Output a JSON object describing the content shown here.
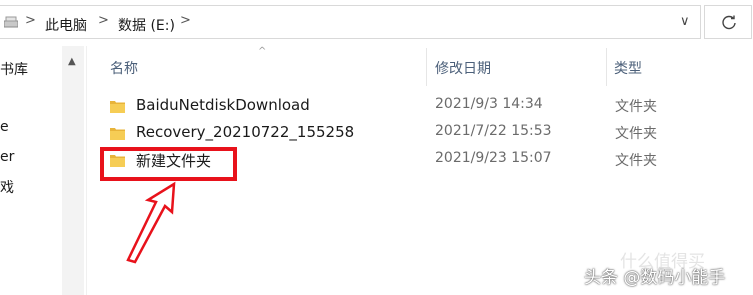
{
  "address_bar": {
    "crumbs": [
      "此电脑",
      "数据 (E:)"
    ],
    "separator": ">",
    "dropdown_glyph": "∨"
  },
  "nav_pane": {
    "items": [
      "书库",
      "e",
      "er",
      "戏"
    ]
  },
  "columns": {
    "name": "名称",
    "modified": "修改日期",
    "type": "类型"
  },
  "files": [
    {
      "name": "BaiduNetdiskDownload",
      "modified": "2021/9/3 14:34",
      "type": "文件夹"
    },
    {
      "name": "Recovery_20210722_155258",
      "modified": "2021/7/22 15:53",
      "type": "文件夹"
    },
    {
      "name": "新建文件夹",
      "modified": "2021/9/23 15:07",
      "type": "文件夹"
    }
  ],
  "watermark": {
    "text": "头条 @数码小能手",
    "faint_text": "什么值得买"
  },
  "colors": {
    "highlight_box": "#e8121b",
    "folder": "#f3c03f",
    "header_text": "#4c607a"
  },
  "icons": [
    "drive-icon",
    "refresh-icon",
    "folder-icon",
    "scroll-up-icon",
    "sort-caret-icon",
    "arrow-annotation"
  ]
}
